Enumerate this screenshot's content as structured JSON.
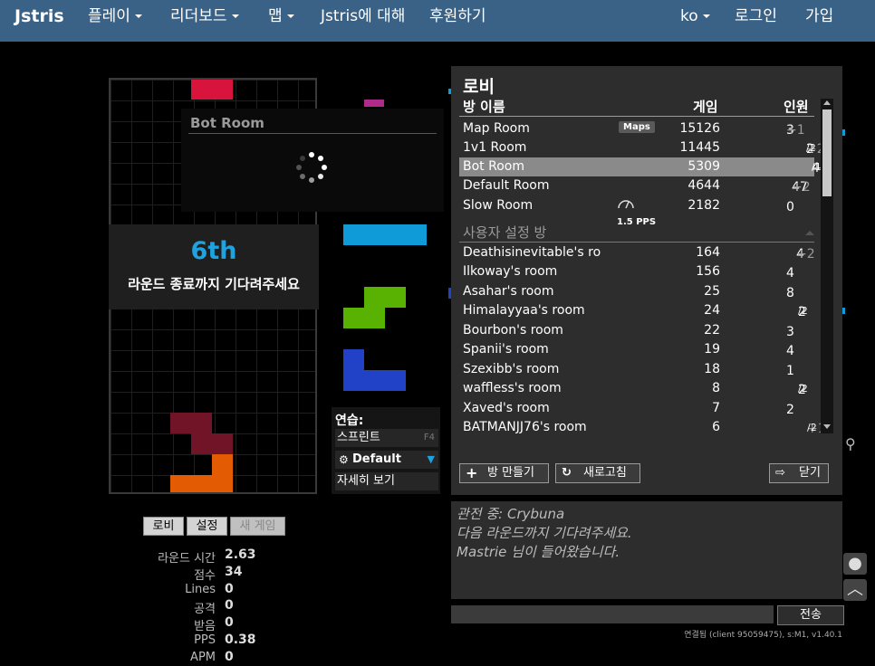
{
  "nav": {
    "brand": "Jstris",
    "play": "플레이",
    "leaderboard": "리더보드",
    "maps": "맵",
    "about": "Jstris에 대해",
    "donate": "후원하기",
    "lang": "ko",
    "login": "로그인",
    "register": "가입"
  },
  "game": {
    "place": "6th",
    "wait_message": "라운드 종료까지 기다려주세요",
    "popup_title": "Bot Room"
  },
  "practice": {
    "title": "연습:",
    "sprint": "스프린트",
    "sprint_key": "F4",
    "mode": "Default",
    "details": "자세히 보기"
  },
  "lobby": {
    "title": "로비",
    "col_name": "방 이름",
    "col_games": "게임",
    "col_players": "인원",
    "maps_badge": "Maps",
    "pps_label": "1.5 PPS",
    "custom_section": "사용자 설정 방",
    "rooms": [
      {
        "name": "Map Room",
        "games": "15126",
        "players": "3",
        "extra": "+1",
        "cap": ""
      },
      {
        "name": "1v1 Room",
        "games": "11445",
        "players": "2",
        "extra": "+2",
        "cap": "/2"
      },
      {
        "name": "Bot Room",
        "games": "5309",
        "players": "4",
        "extra": "+3",
        "cap": "/14"
      },
      {
        "name": "Default Room",
        "games": "4644",
        "players": "47",
        "extra": "+2",
        "cap": ""
      },
      {
        "name": "Slow Room",
        "games": "2182",
        "players": "0",
        "extra": "",
        "cap": ""
      }
    ],
    "custom_rooms": [
      {
        "name": "Deathisinevitable's ro",
        "games": "164",
        "players": "4",
        "extra": "+2",
        "cap": ""
      },
      {
        "name": "Ilkoway's room",
        "games": "156",
        "players": "4",
        "extra": "",
        "cap": ""
      },
      {
        "name": "Asahar's room",
        "games": "25",
        "players": "8",
        "extra": "",
        "cap": ""
      },
      {
        "name": "Himalayyaa's room",
        "games": "24",
        "players": "2",
        "extra": "",
        "cap": "/2"
      },
      {
        "name": "Bourbon's room",
        "games": "22",
        "players": "3",
        "extra": "",
        "cap": ""
      },
      {
        "name": "Spanii's room",
        "games": "19",
        "players": "4",
        "extra": "",
        "cap": ""
      },
      {
        "name": "Szexibb's room",
        "games": "18",
        "players": "1",
        "extra": "",
        "cap": ""
      },
      {
        "name": "waffless's room",
        "games": "8",
        "players": "2",
        "extra": "",
        "cap": "/2"
      },
      {
        "name": "Xaved's room",
        "games": "7",
        "players": "2",
        "extra": "",
        "cap": ""
      },
      {
        "name": "BATMANJJ76's room",
        "games": "6",
        "players": "",
        "extra": "+1",
        "cap": "/2"
      }
    ],
    "create_room": "방 만들기",
    "refresh": "새로고침",
    "close": "닫기"
  },
  "chat": {
    "lines": [
      "관전 중: Crybuna",
      "다음 라운드까지 기다려주세요.",
      "Mastrie 님이 들어왔습니다."
    ],
    "send": "전송",
    "status": "연결됨 (client 95059475), s:M1, v1.40.1"
  },
  "buttons": {
    "lobby": "로비",
    "settings": "설정",
    "new_game": "새 게임"
  },
  "stats": [
    {
      "label": "라운드 시간",
      "value": "2.63"
    },
    {
      "label": "점수",
      "value": "34"
    },
    {
      "label": "Lines",
      "value": "0"
    },
    {
      "label": "공격",
      "value": "0"
    },
    {
      "label": "받음",
      "value": "0"
    },
    {
      "label": "PPS",
      "value": "0.38"
    },
    {
      "label": "APM",
      "value": "0"
    }
  ],
  "colors": {
    "navbar": "#3a6186",
    "place": "#1ea3e0",
    "piece_red": "#d8143c",
    "piece_magenta": "#b02a8a",
    "piece_cyan": "#0f9bd7",
    "piece_green": "#59b101",
    "piece_blue": "#2141c6",
    "piece_darkred": "#721427",
    "piece_orange": "#e35b02"
  }
}
